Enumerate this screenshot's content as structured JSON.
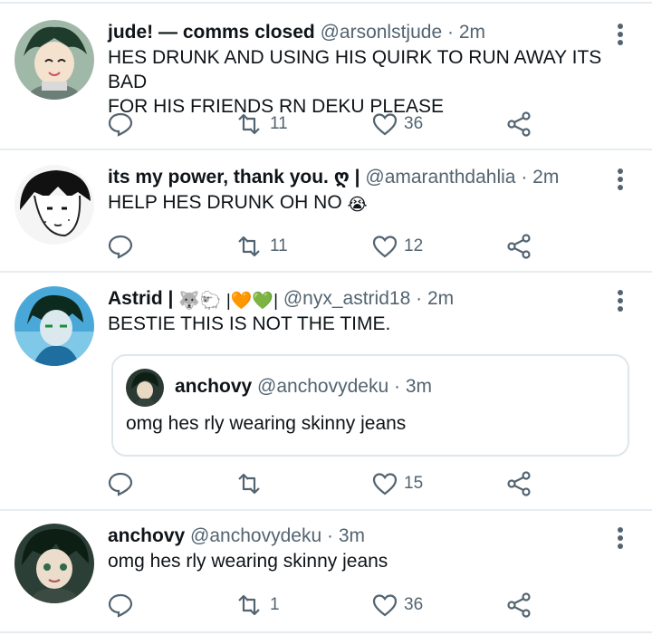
{
  "colors": {
    "text": "#0f1419",
    "secondary": "#536471",
    "divider": "#e6ecf0",
    "heart_outline": "#536471"
  },
  "tweets": [
    {
      "name": "jude! — comms closed",
      "handle": "@arsonlstjude",
      "dot": "·",
      "time": "2m",
      "text": "HES DRUNK AND USING HIS QUIRK TO RUN AWAY ITS BAD\nFOR HIS FRIENDS RN DEKU PLEASE",
      "retweets": "11",
      "likes": "36"
    },
    {
      "name": "its my power, thank you. ღ |",
      "handle": "@amaranthdahlia",
      "dot": "·",
      "time": "2m",
      "text": "HELP HES DRUNK OH NO",
      "text_emoji": "😭",
      "retweets": "11",
      "likes": "12"
    },
    {
      "name": "Astrid |",
      "name_emojis": "🐺🐑 |🧡💚|",
      "handle": "@nyx_astrid18",
      "dot": "·",
      "time": "2m",
      "text": "BESTIE THIS IS NOT THE TIME.",
      "retweets": "",
      "likes": "15",
      "quote": {
        "name": "anchovy",
        "handle": "@anchovydeku",
        "dot": "·",
        "time": "3m",
        "text": "omg hes rly wearing skinny jeans"
      }
    },
    {
      "name": "anchovy",
      "handle": "@anchovydeku",
      "dot": "·",
      "time": "3m",
      "text": "omg hes rly wearing skinny jeans",
      "retweets": "1",
      "likes": "36"
    }
  ]
}
